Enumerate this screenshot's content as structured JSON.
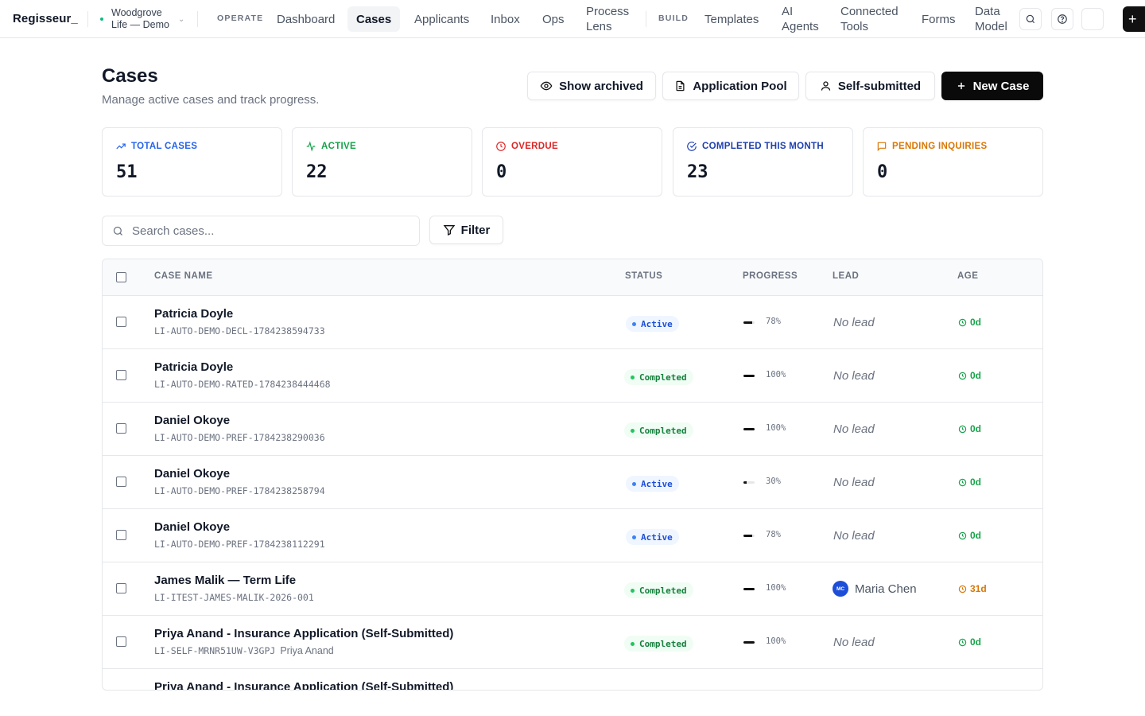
{
  "brand": "Regisseur_",
  "workspace": {
    "name": "Woodgrove Life — Demo",
    "status_color": "#10b981"
  },
  "nav": {
    "operate_label": "OPERATE",
    "build_label": "BUILD",
    "items": [
      {
        "label": "Dashboard",
        "active": false
      },
      {
        "label": "Cases",
        "active": true
      },
      {
        "label": "Applicants",
        "active": false
      },
      {
        "label": "Inbox",
        "active": false
      },
      {
        "label": "Ops",
        "active": false
      },
      {
        "label": "Process Lens",
        "active": false
      },
      {
        "label": "Templates",
        "active": false
      },
      {
        "label": "AI Agents",
        "active": false
      },
      {
        "label": "Connected Tools",
        "active": false
      },
      {
        "label": "Forms",
        "active": false
      },
      {
        "label": "Data Model",
        "active": false
      }
    ],
    "icons": [
      "search-icon",
      "help-icon",
      "plus-icon"
    ]
  },
  "page": {
    "title": "Cases",
    "subtitle": "Manage active cases and track progress.",
    "actions": {
      "show_archived": "Show archived",
      "application_pool": "Application Pool",
      "self_submitted": "Self-submitted",
      "new_case": "New Case"
    }
  },
  "stats": [
    {
      "label": "TOTAL CASES",
      "value": "51",
      "color": "#2563eb",
      "icon": "trending-up-icon"
    },
    {
      "label": "ACTIVE",
      "value": "22",
      "color": "#16a34a",
      "icon": "activity-icon"
    },
    {
      "label": "OVERDUE",
      "value": "0",
      "color": "#dc2626",
      "icon": "clock-icon"
    },
    {
      "label": "COMPLETED THIS MONTH",
      "value": "23",
      "color": "#1e40af",
      "icon": "check-circle-icon"
    },
    {
      "label": "PENDING INQUIRIES",
      "value": "0",
      "color": "#d97706",
      "icon": "message-icon"
    }
  ],
  "search": {
    "placeholder": "Search cases..."
  },
  "filter": {
    "label": "Filter"
  },
  "table": {
    "columns": {
      "case_name": "CASE NAME",
      "status": "STATUS",
      "progress": "PROGRESS",
      "lead": "LEAD",
      "age": "AGE"
    },
    "rows": [
      {
        "name": "Patricia Doyle",
        "id": "LI-AUTO-DEMO-DECL-1784238594733",
        "owner": "",
        "status": "Active",
        "progress": 78,
        "progress_label": "78%",
        "lead": "No lead",
        "age": "0d"
      },
      {
        "name": "Patricia Doyle",
        "id": "LI-AUTO-DEMO-RATED-1784238444468",
        "owner": "",
        "status": "Completed",
        "progress": 100,
        "progress_label": "100%",
        "lead": "No lead",
        "age": "0d"
      },
      {
        "name": "Daniel Okoye",
        "id": "LI-AUTO-DEMO-PREF-1784238290036",
        "owner": "",
        "status": "Completed",
        "progress": 100,
        "progress_label": "100%",
        "lead": "No lead",
        "age": "0d"
      },
      {
        "name": "Daniel Okoye",
        "id": "LI-AUTO-DEMO-PREF-1784238258794",
        "owner": "",
        "status": "Active",
        "progress": 30,
        "progress_label": "30%",
        "lead": "No lead",
        "age": "0d"
      },
      {
        "name": "Daniel Okoye",
        "id": "LI-AUTO-DEMO-PREF-1784238112291",
        "owner": "",
        "status": "Active",
        "progress": 78,
        "progress_label": "78%",
        "lead": "No lead",
        "age": "0d"
      },
      {
        "name": "James Malik — Term Life",
        "id": "LI-ITEST-JAMES-MALIK-2026-001",
        "owner": "",
        "status": "Completed",
        "progress": 100,
        "progress_label": "100%",
        "lead": "Maria Chen",
        "lead_initials": "MC",
        "age": "31d"
      },
      {
        "name": "Priya Anand - Insurance Application (Self-Submitted)",
        "id": "LI-SELF-MRNR51UW-V3GPJ",
        "owner": "Priya Anand",
        "status": "Completed",
        "progress": 100,
        "progress_label": "100%",
        "lead": "No lead",
        "age": "0d"
      },
      {
        "name": "Priya Anand - Insurance Application (Self-Submitted)",
        "id": "",
        "owner": "",
        "status": "",
        "progress": null,
        "progress_label": "",
        "lead": "",
        "age": ""
      }
    ],
    "age_colors": {
      "fresh": "#16a34a",
      "old": "#d97706"
    }
  }
}
